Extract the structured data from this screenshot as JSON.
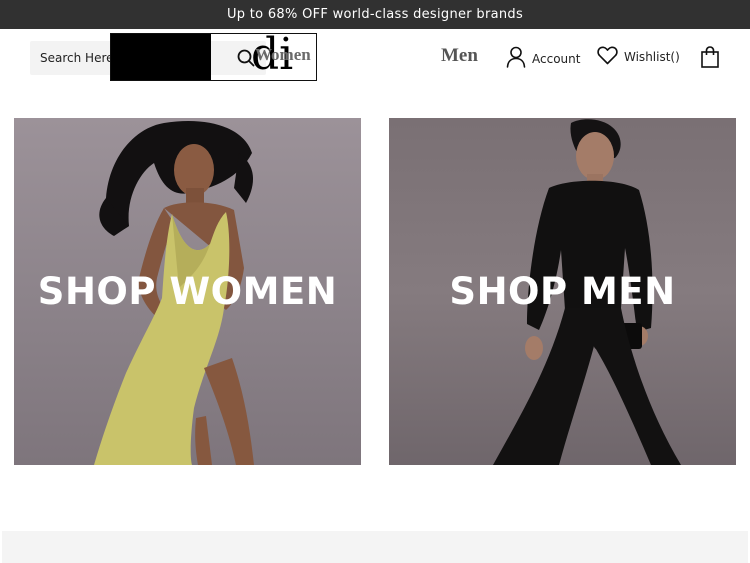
{
  "announcement": "Up to 68% OFF world-class designer brands",
  "search": {
    "placeholder": "Search Here"
  },
  "logo": {
    "text": "di"
  },
  "nav": {
    "women": "Women",
    "men": "Men"
  },
  "header_actions": {
    "account": "Account",
    "wishlist": "Wishlist()"
  },
  "tiles": {
    "women": "SHOP WOMEN",
    "men": "SHOP MEN"
  },
  "colors": {
    "announcement_bg": "#313131",
    "tile_text": "#ffffff",
    "women_dress": "#c9c36a"
  }
}
